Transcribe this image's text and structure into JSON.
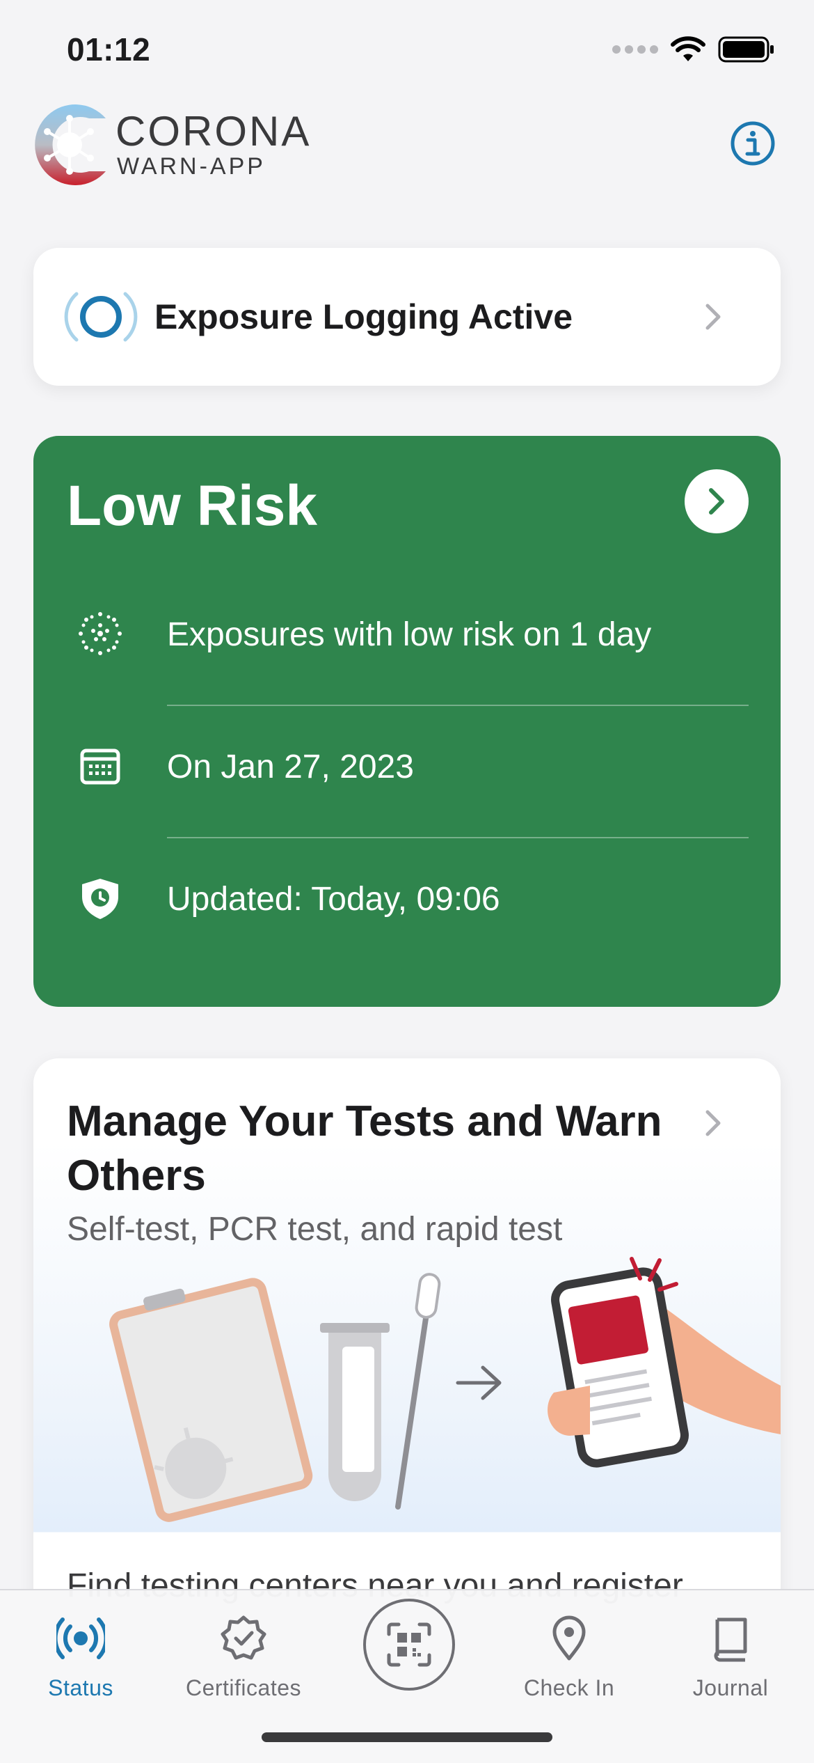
{
  "status_bar": {
    "time": "01:12"
  },
  "header": {
    "brand_line1": "CORONA",
    "brand_line2": "WARN-APP",
    "info_icon": "info-icon"
  },
  "exposure_card": {
    "title": "Exposure Logging Active",
    "icon": "exposure-logging-icon"
  },
  "risk_card": {
    "title": "Low Risk",
    "color": "#2f854d",
    "rows": [
      {
        "icon": "virus-dots-icon",
        "text": "Exposures with low risk on 1 day"
      },
      {
        "icon": "calendar-icon",
        "text": "On Jan 27, 2023"
      },
      {
        "icon": "shield-clock-icon",
        "text": "Updated: Today, 09:06"
      }
    ]
  },
  "tests_card": {
    "title": "Manage Your Tests and Warn Others",
    "subtitle": "Self-test, PCR test, and rapid test",
    "body": "Find testing centers near you and register"
  },
  "tab_bar": {
    "tabs": [
      {
        "label": "Status",
        "icon": "status-icon",
        "active": true
      },
      {
        "label": "Certificates",
        "icon": "certificate-icon",
        "active": false
      },
      {
        "label": "",
        "icon": "qr-scan-icon",
        "active": false
      },
      {
        "label": "Check In",
        "icon": "location-pin-icon",
        "active": false
      },
      {
        "label": "Journal",
        "icon": "journal-icon",
        "active": false
      }
    ],
    "accent": "#1d78b0"
  }
}
